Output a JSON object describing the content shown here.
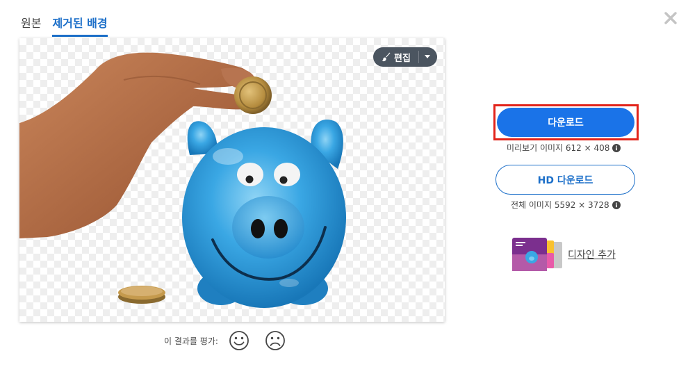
{
  "tabs": [
    {
      "label": "원본",
      "active": false
    },
    {
      "label": "제거된 배경",
      "active": true
    }
  ],
  "editor": {
    "edit_label": "편집"
  },
  "download": {
    "button_label": "다운로드",
    "preview_info": "미리보기 이미지 612 × 408",
    "hd_button_label": "HD 다운로드",
    "full_info": "전체 이미지 5592 × 3728"
  },
  "design": {
    "add_label": "디자인 추가"
  },
  "rating": {
    "label": "이 결과를 평가:"
  },
  "colors": {
    "accent": "#1a73e8",
    "highlight": "#e2231a",
    "tab_active": "#1c6fc9"
  }
}
